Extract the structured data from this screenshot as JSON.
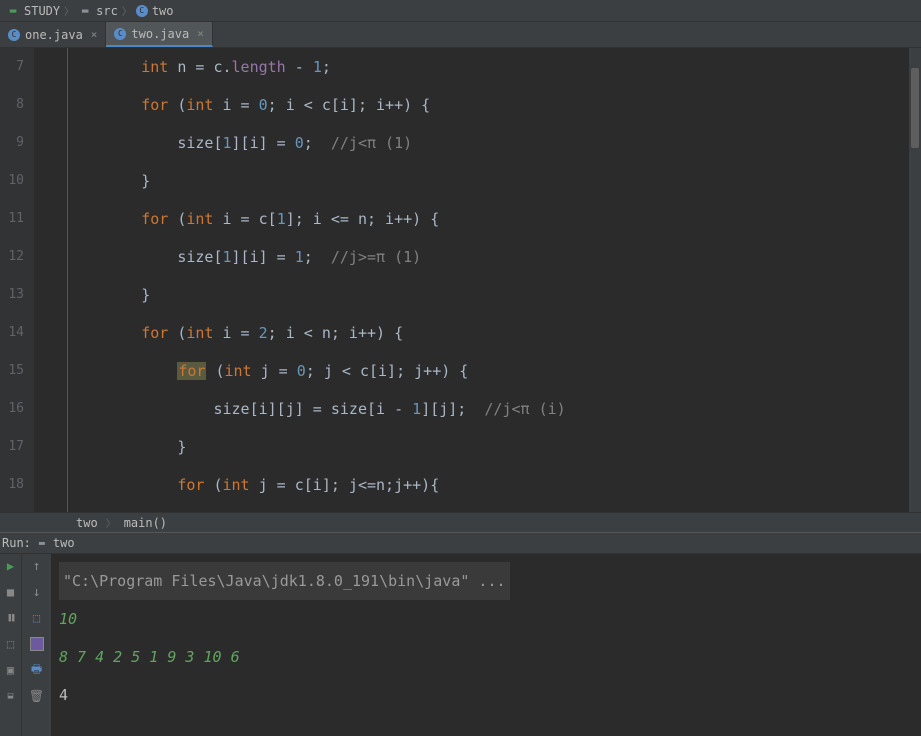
{
  "breadcrumb": {
    "items": [
      {
        "label": "STUDY"
      },
      {
        "label": "src"
      },
      {
        "label": "two"
      }
    ]
  },
  "tabs": {
    "items": [
      {
        "label": "one.java",
        "active": false
      },
      {
        "label": "two.java",
        "active": true
      }
    ]
  },
  "gutter": {
    "lines": [
      "7",
      "8",
      "9",
      "10",
      "11",
      "12",
      "13",
      "14",
      "15",
      "16",
      "17",
      "18"
    ]
  },
  "code": {
    "l7": {
      "kw1": "int",
      "rest": " n = c.",
      "field": "length",
      "rest2": " - ",
      "num": "1",
      "end": ";"
    },
    "l8": {
      "kw1": "for",
      "p1": " (",
      "kw2": "int",
      "mid": " i = ",
      "num1": "0",
      "mid2": "; i < c[i]; i++) {"
    },
    "l9": {
      "txt": "size[",
      "num1": "1",
      "txt2": "][i] = ",
      "num2": "0",
      "txt3": ";  ",
      "com": "//j<π (1)"
    },
    "l10": {
      "txt": "}"
    },
    "l11": {
      "kw1": "for",
      "p1": " (",
      "kw2": "int",
      "mid": " i = c[",
      "num1": "1",
      "mid2": "]; i <= n; i++) {"
    },
    "l12": {
      "txt": "size[",
      "num1": "1",
      "txt2": "][i] = ",
      "num2": "1",
      "txt3": ";  ",
      "com": "//j>=π (1)"
    },
    "l13": {
      "txt": "}"
    },
    "l14": {
      "kw1": "for",
      "p1": " (",
      "kw2": "int",
      "mid": " i = ",
      "num1": "2",
      "mid2": "; i < n; i++) {"
    },
    "l15": {
      "hl": "for",
      "p1": " (",
      "kw2": "int",
      "mid": " j = ",
      "num1": "0",
      "mid2": "; j < c[i]; j++) {"
    },
    "l16": {
      "txt": "size[i][j] = size[i - ",
      "num1": "1",
      "txt2": "][j];  ",
      "com": "//j<π (i)"
    },
    "l17": {
      "txt": "}"
    },
    "l18": {
      "kw1": "for",
      "p1": " (",
      "kw2": "int",
      "mid": " j = c[i]; j<=n;j++){"
    }
  },
  "context": {
    "item1": "two",
    "item2": "main()"
  },
  "run": {
    "label": "Run:",
    "name": "two"
  },
  "console": {
    "cmd": "\"C:\\Program Files\\Java\\jdk1.8.0_191\\bin\\java\" ...",
    "out1": "10",
    "out2": "8 7 4 2 5 1 9 3 10 6",
    "out3": "4"
  }
}
